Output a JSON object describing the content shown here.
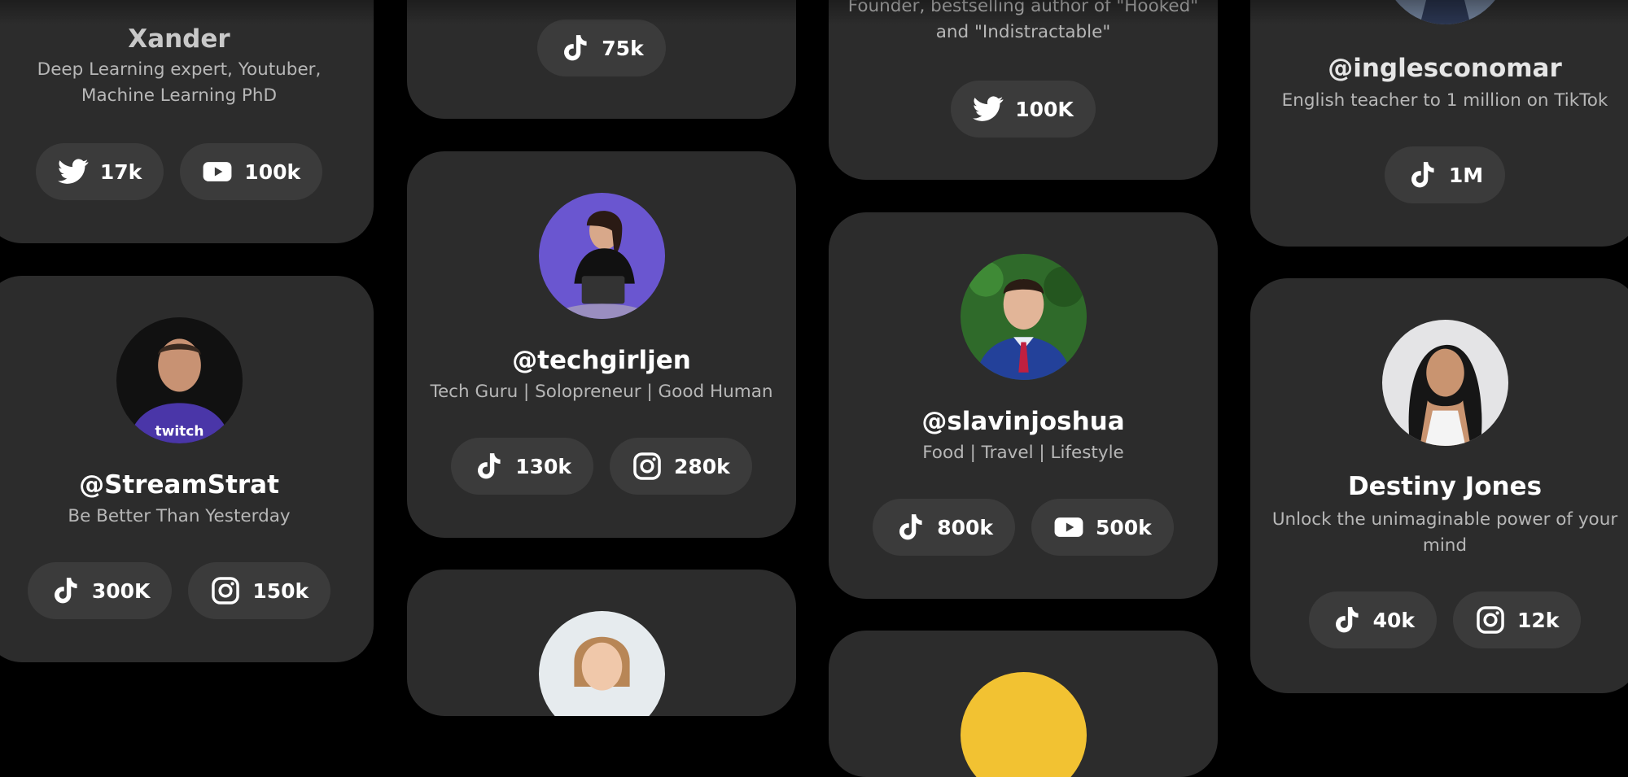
{
  "cards": {
    "xander": {
      "name": "Xander",
      "bio": "Deep Learning expert, Youtuber, Machine Learning PhD",
      "stats": [
        {
          "platform": "twitter",
          "value": "17k"
        },
        {
          "platform": "youtube",
          "value": "100k"
        }
      ]
    },
    "streamstrat": {
      "name": "@StreamStrat",
      "bio": "Be Better Than Yesterday",
      "stats": [
        {
          "platform": "tiktok",
          "value": "300K"
        },
        {
          "platform": "instagram",
          "value": "150k"
        }
      ]
    },
    "top_tiktok": {
      "stats": [
        {
          "platform": "tiktok",
          "value": "75k"
        }
      ]
    },
    "techgirljen": {
      "name": "@techgirljen",
      "bio": "Tech Guru | Solopreneur | Good Human",
      "stats": [
        {
          "platform": "tiktok",
          "value": "130k"
        },
        {
          "platform": "instagram",
          "value": "280k"
        }
      ]
    },
    "founder": {
      "bio_line1": "Founder, bestselling author of \"Hooked\"",
      "bio_line2": "and \"Indistractable\"",
      "stats": [
        {
          "platform": "twitter",
          "value": "100K"
        }
      ]
    },
    "slavinjoshua": {
      "name": "@slavinjoshua",
      "bio": "Food | Travel | Lifestyle",
      "stats": [
        {
          "platform": "tiktok",
          "value": "800k"
        },
        {
          "platform": "youtube",
          "value": "500k"
        }
      ]
    },
    "inglesconomar": {
      "name": "@inglesconomar",
      "bio": "English teacher to 1 million on TikTok",
      "stats": [
        {
          "platform": "tiktok",
          "value": "1M"
        }
      ]
    },
    "destiny": {
      "name": "Destiny Jones",
      "bio": "Unlock the unimaginable power of your mind",
      "stats": [
        {
          "platform": "tiktok",
          "value": "40k"
        },
        {
          "platform": "instagram",
          "value": "12k"
        }
      ]
    }
  },
  "colors": {
    "background": "#000000",
    "card": "#2c2c2c",
    "pill": "#3b3b3b",
    "bio_text": "#b7b7b7"
  }
}
